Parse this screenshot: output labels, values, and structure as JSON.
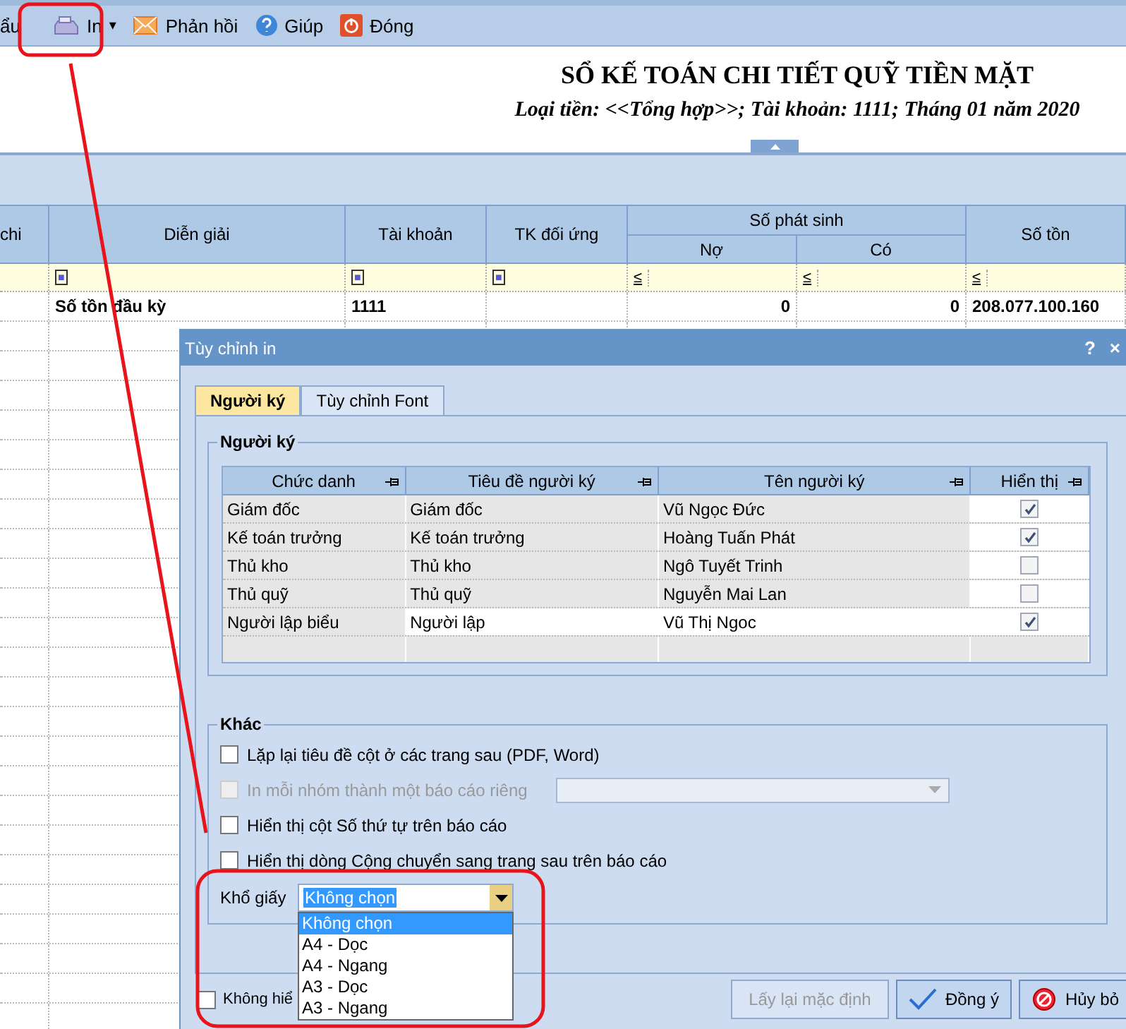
{
  "toolbar": {
    "items": [
      {
        "kind": "text",
        "label": "ẩu"
      },
      {
        "kind": "print",
        "label": "In",
        "caret": "▾"
      },
      {
        "kind": "feedback",
        "label": "Phản hồi"
      },
      {
        "kind": "help",
        "label": "Giúp"
      },
      {
        "kind": "close",
        "label": "Đóng"
      }
    ]
  },
  "report": {
    "title": "SỔ KẾ TOÁN CHI TIẾT QUỸ TIỀN MẶT",
    "subtitle": "Loại tiền: <<Tổng hợp>>; Tài khoản: 1111; Tháng 01 năm 2020"
  },
  "table": {
    "columns": [
      {
        "label": "chi"
      },
      {
        "label": "Diễn giải"
      },
      {
        "label": "Tài khoản"
      },
      {
        "label": "TK đối ứng"
      },
      {
        "label": "Nợ",
        "group": "Số phát sinh"
      },
      {
        "label": "Có",
        "grouped": true
      },
      {
        "label": "Số tồn"
      }
    ],
    "filter": [
      "■",
      "■",
      "■",
      "≤",
      "≤",
      "≤"
    ],
    "rows": [
      {
        "cells": [
          "",
          "Số tồn đầu kỳ",
          "1111",
          "",
          "0",
          "0",
          "208.077.100.160"
        ]
      }
    ]
  },
  "dialog": {
    "title": "Tùy chỉnh in",
    "help": "?",
    "close": "×",
    "tabs": [
      {
        "label": "Người ký",
        "selected": true
      },
      {
        "label": "Tùy chỉnh Font",
        "selected": false
      }
    ],
    "signers": {
      "legend": "Người ký",
      "columns": [
        "Chức danh",
        "Tiêu đề người ký",
        "Tên người ký",
        "Hiển thị"
      ],
      "rows": [
        {
          "role": "Giám đốc",
          "heading": "Giám đốc",
          "name": "Vũ Ngọc Đức",
          "shown": true,
          "selected": false
        },
        {
          "role": "Kế toán trưởng",
          "heading": "Kế toán trưởng",
          "name": "Hoàng Tuấn Phát",
          "shown": true,
          "selected": false
        },
        {
          "role": "Thủ kho",
          "heading": "Thủ kho",
          "name": "Ngô Tuyết Trinh",
          "shown": false,
          "selected": false
        },
        {
          "role": "Thủ quỹ",
          "heading": "Thủ quỹ",
          "name": "Nguyễn Mai Lan",
          "shown": false,
          "selected": false
        },
        {
          "role": "Người lập biểu",
          "heading": "Người lập",
          "name": "Vũ Thị Ngoc",
          "shown": true,
          "selected": true
        }
      ]
    },
    "other": {
      "legend": "Khác",
      "options": [
        {
          "kind": "check",
          "label": "Lặp lại tiêu đề cột ở các trang sau (PDF, Word)",
          "checked": false,
          "disabled": false
        },
        {
          "kind": "select",
          "label": "In mỗi nhóm thành một báo cáo riêng",
          "checked": false,
          "disabled": true
        },
        {
          "kind": "check",
          "label": "Hiển thị cột Số thứ tự trên báo cáo",
          "checked": false,
          "disabled": false
        },
        {
          "kind": "check",
          "label": "Hiển thị dòng Cộng chuyển sang trang sau trên báo cáo",
          "checked": false,
          "disabled": false
        }
      ],
      "paper": {
        "label": "Khổ giấy",
        "value": "Không chọn",
        "options": [
          {
            "label": "Không chọn",
            "selected": true
          },
          {
            "label": "A4 - Dọc",
            "selected": false
          },
          {
            "label": "A4 - Ngang",
            "selected": false
          },
          {
            "label": "A3 - Dọc",
            "selected": false
          },
          {
            "label": "A3 - Ngang",
            "selected": false
          }
        ]
      }
    },
    "footer_check": {
      "label": "Không hiể",
      "checked": false
    },
    "buttons": [
      {
        "kind": "default",
        "label": "Lấy lại mặc định",
        "disabled": true
      },
      {
        "kind": "ok",
        "label": "Đồng ý",
        "disabled": false
      },
      {
        "kind": "cancel",
        "label": "Hủy bỏ",
        "disabled": false
      }
    ]
  }
}
